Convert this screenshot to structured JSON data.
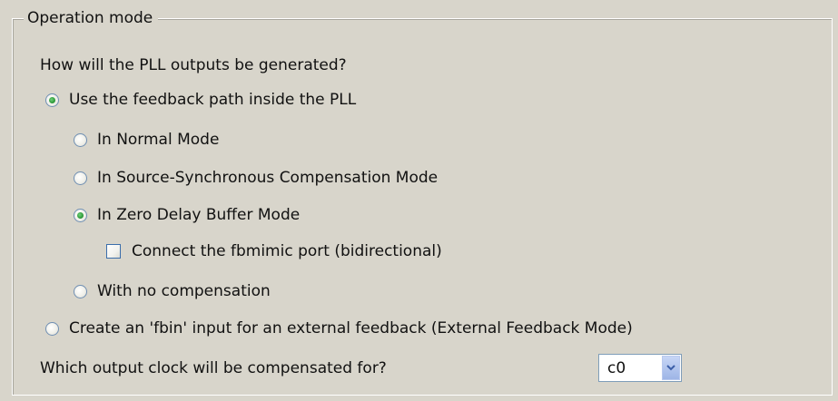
{
  "group": {
    "title": "Operation mode"
  },
  "question1": "How will the PLL outputs be generated?",
  "options": {
    "feedback_inside": {
      "label": "Use the feedback path inside the PLL",
      "selected": true
    },
    "normal_mode": {
      "label": "In Normal Mode",
      "selected": false
    },
    "source_sync": {
      "label": "In Source-Synchronous Compensation Mode",
      "selected": false
    },
    "zero_delay": {
      "label": "In Zero Delay Buffer Mode",
      "selected": true
    },
    "fbmimic": {
      "label": "Connect the fbmimic port (bidirectional)",
      "checked": false
    },
    "no_comp": {
      "label": "With no compensation",
      "selected": false
    },
    "external_fb": {
      "label": "Create an 'fbin' input for an external feedback (External Feedback Mode)",
      "selected": false
    }
  },
  "question2": "Which output clock will be compensated for?",
  "clock_select": {
    "value": "c0",
    "icon": "chevron-down-icon"
  }
}
